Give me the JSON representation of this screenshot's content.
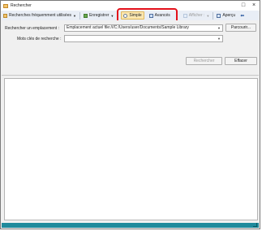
{
  "window": {
    "title": "Rechercher"
  },
  "toolbar": {
    "frequent_label": "Recherches fréquemment utilisées",
    "save_label": "Enregistrer",
    "simple_label": "Simple",
    "advanced_label": "Avancés",
    "display_label": "Afficher :",
    "preview_label": "Aperçu"
  },
  "form": {
    "location_label": "Rechercher un emplacement :",
    "location_value": "Emplacement actuel file:///C:/Users/user/Documents/Sample Library",
    "browse_label": "Parcourir...",
    "keywords_label": "Mots clés de recherche :",
    "keywords_value": "",
    "search_button": "Rechercher",
    "clear_button": "Effacer"
  },
  "colors": {
    "accent": "#1f8a9c",
    "highlight": "#e3111b"
  },
  "icons": {
    "app": "folder-search-icon",
    "frequent": "list-icon",
    "save": "save-icon",
    "simple": "magnifier-icon",
    "advanced": "advanced-search-icon",
    "display": "view-icon",
    "preview": "preview-icon"
  }
}
